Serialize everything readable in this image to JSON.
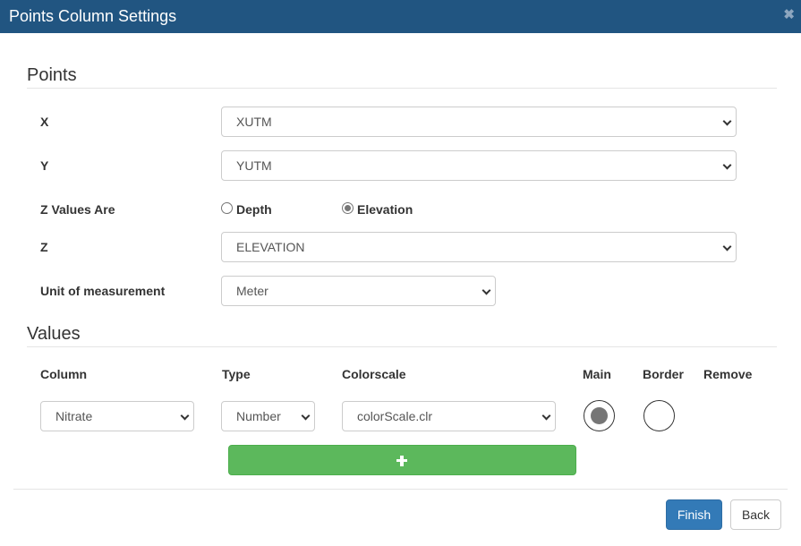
{
  "dialog": {
    "title": "Points Column Settings",
    "close_glyph": "✖"
  },
  "points": {
    "heading": "Points",
    "x": {
      "label": "X",
      "value": "XUTM"
    },
    "y": {
      "label": "Y",
      "value": "YUTM"
    },
    "z_values": {
      "label": "Z Values Are",
      "options": [
        "Depth",
        "Elevation"
      ],
      "selected": "Elevation"
    },
    "z": {
      "label": "Z",
      "value": "ELEVATION"
    },
    "unit": {
      "label": "Unit of measurement",
      "value": "Meter"
    }
  },
  "values": {
    "heading": "Values",
    "headers": {
      "column": "Column",
      "type": "Type",
      "colorscale": "Colorscale",
      "main": "Main",
      "border": "Border",
      "remove": "Remove"
    },
    "rows": [
      {
        "column": "Nitrate",
        "type": "Number",
        "colorscale": "colorScale.clr",
        "main": true,
        "border": false
      }
    ],
    "add_icon": "plus-icon"
  },
  "footer": {
    "finish_label": "Finish",
    "back_label": "Back"
  },
  "colors": {
    "titlebar": "#215581",
    "primary": "#337ab7",
    "success": "#5cb85c"
  }
}
